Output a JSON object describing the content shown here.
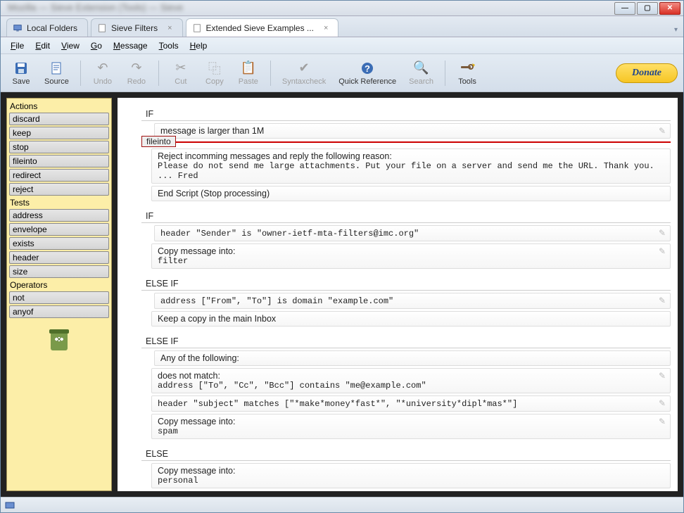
{
  "titlebar": {
    "minimize": "—",
    "maximize": "▢",
    "close": "✕",
    "blur_text": "Mozilla — Sieve Extension (Tools) — Sieve"
  },
  "tabs": [
    {
      "label": "Local Folders",
      "closeable": false,
      "active": false
    },
    {
      "label": "Sieve Filters",
      "closeable": true,
      "active": false
    },
    {
      "label": "Extended Sieve Examples ...",
      "closeable": true,
      "active": true
    }
  ],
  "tabnav": {
    "dropdown": "▾"
  },
  "menubar": [
    "File",
    "Edit",
    "View",
    "Go",
    "Message",
    "Tools",
    "Help"
  ],
  "toolbar": {
    "save": "Save",
    "source": "Source",
    "undo": "Undo",
    "redo": "Redo",
    "cut": "Cut",
    "copy": "Copy",
    "paste": "Paste",
    "syntaxcheck": "Syntaxcheck",
    "quickref": "Quick Reference",
    "search": "Search",
    "tools": "Tools",
    "donate": "Donate"
  },
  "sidebar": {
    "actions_head": "Actions",
    "actions": [
      "discard",
      "keep",
      "stop",
      "fileinto",
      "redirect",
      "reject"
    ],
    "tests_head": "Tests",
    "tests": [
      "address",
      "envelope",
      "exists",
      "header",
      "size"
    ],
    "ops_head": "Operators",
    "ops": [
      "not",
      "anyof"
    ]
  },
  "dragchip": "fileinto",
  "editor": {
    "b1": {
      "if": "IF",
      "cond": "message is larger than 1M",
      "reject_head": "Reject incomming messages and reply the following reason:",
      "reject_body": "Please do not send me large attachments. Put your file on a server and send me the URL. Thank you. ... Fred",
      "end": "End Script (Stop processing)"
    },
    "b2": {
      "if": "IF",
      "cond": "header \"Sender\" is \"owner-ietf-mta-filters@imc.org\"",
      "action_head": "Copy message into:",
      "action_body": "filter"
    },
    "b3": {
      "elseif": "ELSE IF",
      "cond": "address [\"From\", \"To\"] is domain \"example.com\"",
      "action": "Keep a copy in the main Inbox"
    },
    "b4": {
      "elseif": "ELSE IF",
      "any": "Any of the following:",
      "nm_head": "does not match:",
      "nm_body": "address [\"To\", \"Cc\", \"Bcc\"] contains \"me@example.com\"",
      "hm": "header \"subject\" matches [\"*make*money*fast*\", \"*university*dipl*mas*\"]",
      "action_head": "Copy message into:",
      "action_body": "spam"
    },
    "b5": {
      "else": "ELSE",
      "action_head": "Copy message into:",
      "action_body": "personal"
    }
  },
  "pencil": "✎"
}
